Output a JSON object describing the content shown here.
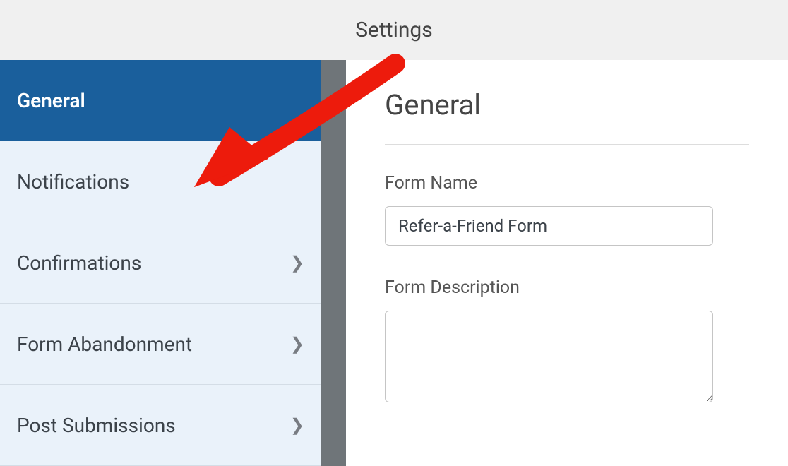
{
  "header": {
    "title": "Settings"
  },
  "sidebar": {
    "items": [
      {
        "label": "General",
        "has_chevron": false,
        "active": true
      },
      {
        "label": "Notifications",
        "has_chevron": false,
        "active": false
      },
      {
        "label": "Confirmations",
        "has_chevron": true,
        "active": false
      },
      {
        "label": "Form Abandonment",
        "has_chevron": true,
        "active": false
      },
      {
        "label": "Post Submissions",
        "has_chevron": true,
        "active": false
      }
    ]
  },
  "content": {
    "title": "General",
    "form_name_label": "Form Name",
    "form_name_value": "Refer-a-Friend Form",
    "form_description_label": "Form Description",
    "form_description_value": ""
  },
  "annotation": {
    "type": "arrow",
    "color": "#ed1b0c",
    "target": "Notifications"
  }
}
